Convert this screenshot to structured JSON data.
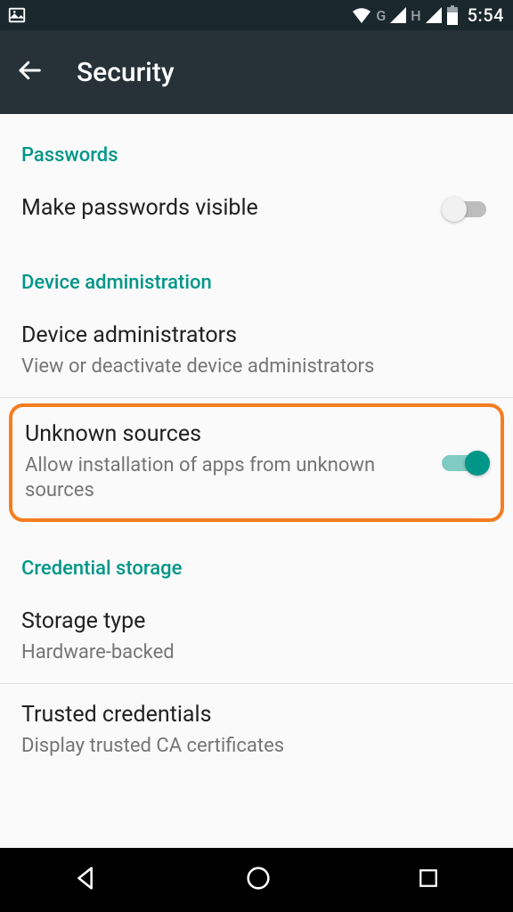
{
  "status": {
    "g_label": "G",
    "h_label": "H",
    "time": "5:54"
  },
  "header": {
    "title": "Security"
  },
  "sections": {
    "passwords": {
      "header": "Passwords",
      "make_visible": {
        "title": "Make passwords visible"
      }
    },
    "device_admin": {
      "header": "Device administration",
      "administrators": {
        "title": "Device administrators",
        "sub": "View or deactivate device administrators"
      },
      "unknown_sources": {
        "title": "Unknown sources",
        "sub": "Allow installation of apps from unknown sources"
      }
    },
    "cred_storage": {
      "header": "Credential storage",
      "storage_type": {
        "title": "Storage type",
        "sub": "Hardware-backed"
      },
      "trusted": {
        "title": "Trusted credentials",
        "sub": "Display trusted CA certificates"
      }
    }
  }
}
